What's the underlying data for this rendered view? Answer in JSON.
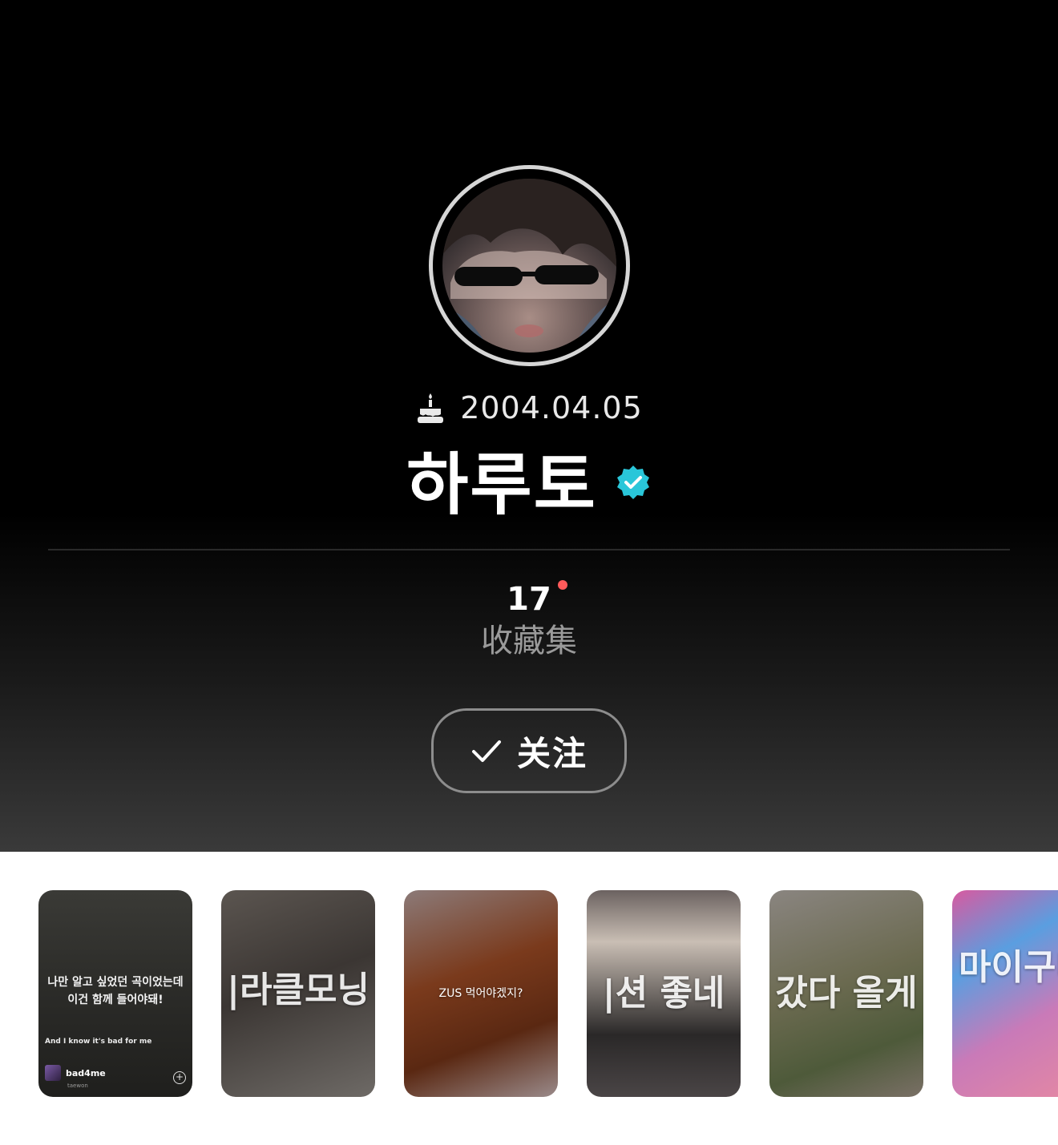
{
  "profile": {
    "birthday": "2004.04.05",
    "name": "하루토",
    "verified": true,
    "stats": {
      "count": "17",
      "label": "收藏集",
      "has_new": true
    },
    "follow_button": {
      "label": "关注",
      "state": "following"
    }
  },
  "colors": {
    "background_top": "#000000",
    "background_bottom": "#3a3a3a",
    "verified_badge": "#29c6d9",
    "new_dot": "#ff5a5a",
    "label_gray": "#9a9a9a"
  },
  "icons": {
    "birthday": "cake-icon",
    "verified": "verified-badge-icon",
    "follow": "check-icon"
  },
  "stories": [
    {
      "lyrics_line1": "나만 알고 싶었던 곡이었는데",
      "lyrics_line2": "이건 함께 들어야돼!",
      "lyric_line": "And I know it's bad for me",
      "track": "bad4me",
      "artist": "taewon"
    },
    {
      "caption": "|라클모닝"
    },
    {
      "caption": "ZUS 먹어야겠지?"
    },
    {
      "caption": "|션 좋네"
    },
    {
      "caption": "갔다 올게"
    },
    {
      "caption": "마이구미"
    }
  ]
}
